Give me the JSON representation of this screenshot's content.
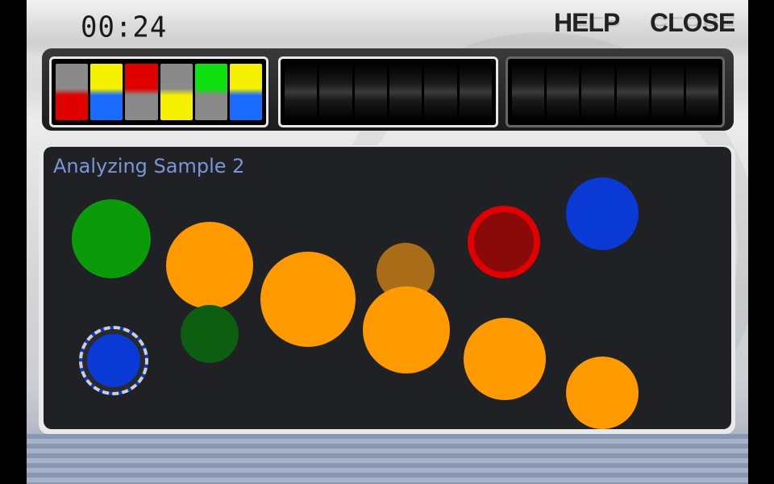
{
  "timer": "00:24",
  "buttons": {
    "help": "HELP",
    "close": "CLOSE"
  },
  "colors": {
    "red": "#e00000",
    "yellow": "#f5f000",
    "blue": "#1a6bff",
    "green": "#10e010",
    "gray": "#8a8a8a",
    "orange": "#ff9a00",
    "dark_orange": "#a86d16",
    "dark_green": "#0e5e12",
    "ball_green": "#0a9a0a",
    "ball_blue": "#0a3ad6",
    "ball_darkred": "#8a0a0a",
    "ring_red": "#e00000"
  },
  "sequence_slots": [
    {
      "top": "gray",
      "bottom": "red"
    },
    {
      "top": "yellow",
      "bottom": "blue"
    },
    {
      "top": "red",
      "bottom": "gray"
    },
    {
      "top": "gray",
      "bottom": "yellow"
    },
    {
      "top": "green",
      "bottom": "gray"
    },
    {
      "top": "yellow",
      "bottom": "blue"
    }
  ],
  "panel": {
    "title": "Analyzing Sample 2"
  },
  "balls": [
    {
      "name": "green-ball",
      "color": "ball_green"
    },
    {
      "name": "orange-ball-1",
      "color": "orange"
    },
    {
      "name": "dark-green-ball",
      "color": "dark_green"
    },
    {
      "name": "orange-ball-2",
      "color": "orange"
    },
    {
      "name": "dim-orange-ball",
      "color": "dark_orange"
    },
    {
      "name": "orange-ball-3",
      "color": "orange"
    },
    {
      "name": "dark-red-ball",
      "color": "ball_darkred",
      "ring": "ring_red"
    },
    {
      "name": "blue-ball",
      "color": "ball_blue"
    },
    {
      "name": "orange-ball-4",
      "color": "orange"
    },
    {
      "name": "orange-ball-5",
      "color": "orange"
    },
    {
      "name": "selected-blue-ball",
      "color": "ball_blue",
      "selected": true
    }
  ]
}
